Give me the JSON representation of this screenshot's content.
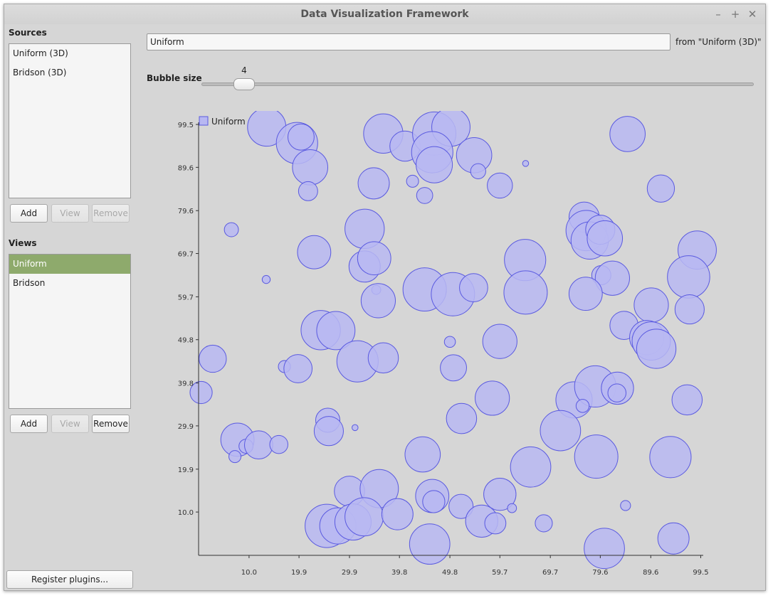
{
  "window": {
    "title": "Data Visualization Framework"
  },
  "sidebar": {
    "sources_label": "Sources",
    "sources": [
      "Uniform (3D)",
      "Bridson (3D)"
    ],
    "sources_buttons": {
      "add": "Add",
      "view": "View",
      "remove": "Remove"
    },
    "views_label": "Views",
    "views": [
      "Uniform",
      "Bridson"
    ],
    "views_selected": "Uniform",
    "views_buttons": {
      "add": "Add",
      "view": "View",
      "remove": "Remove"
    },
    "register_button": "Register plugins..."
  },
  "main": {
    "view_name": "Uniform",
    "from_label": "from \"Uniform (3D)\"",
    "bubble_size_label": "Bubble size",
    "bubble_size_value": "4"
  },
  "colors": {
    "bubble_fill": "#b8b8f2",
    "bubble_stroke": "#5a5ae0",
    "selected": "#8eaa6c"
  },
  "chart_data": {
    "type": "scatter",
    "legend": "Uniform",
    "legend_position": "top-left",
    "xlim": [
      0,
      100
    ],
    "ylim": [
      0,
      100
    ],
    "xticks": [
      "10.0",
      "19.9",
      "29.9",
      "39.8",
      "49.8",
      "59.7",
      "69.7",
      "79.6",
      "89.6",
      "99.5"
    ],
    "yticks": [
      "10.0",
      "19.9",
      "29.9",
      "39.8",
      "49.8",
      "59.7",
      "69.7",
      "79.6",
      "89.6",
      "99.5"
    ],
    "grid": false,
    "points": [
      [
        13.5,
        98.9,
        3.8
      ],
      [
        19.5,
        95.2,
        4.1
      ],
      [
        20.3,
        96.6,
        2.6
      ],
      [
        22.1,
        89.6,
        3.5
      ],
      [
        21.7,
        84.1,
        1.9
      ],
      [
        36.6,
        97.4,
        3.9
      ],
      [
        40.9,
        94.5,
        3.0
      ],
      [
        46.7,
        97.4,
        4.3
      ],
      [
        50.0,
        98.9,
        3.8
      ],
      [
        46.3,
        93.1,
        4.1
      ],
      [
        46.7,
        90.2,
        3.6
      ],
      [
        54.6,
        92.4,
        3.5
      ],
      [
        55.4,
        88.7,
        1.5
      ],
      [
        34.7,
        85.9,
        3.1
      ],
      [
        42.4,
        86.4,
        1.2
      ],
      [
        44.8,
        83.1,
        1.6
      ],
      [
        59.7,
        85.4,
        2.5
      ],
      [
        64.8,
        90.5,
        0.6
      ],
      [
        85.0,
        97.3,
        3.5
      ],
      [
        91.6,
        84.7,
        2.7
      ],
      [
        6.5,
        75.2,
        1.4
      ],
      [
        32.9,
        75.4,
        3.9
      ],
      [
        22.9,
        70.0,
        3.3
      ],
      [
        32.9,
        66.7,
        3.1
      ],
      [
        34.8,
        68.6,
        3.3
      ],
      [
        76.4,
        78.1,
        3.0
      ],
      [
        76.8,
        75.0,
        4.0
      ],
      [
        77.5,
        72.7,
        3.7
      ],
      [
        79.6,
        75.2,
        2.9
      ],
      [
        80.5,
        73.2,
        3.5
      ],
      [
        98.8,
        70.5,
        3.8
      ],
      [
        64.7,
        68.2,
        4.1
      ],
      [
        79.8,
        64.7,
        1.9
      ],
      [
        82.0,
        64.0,
        3.4
      ],
      [
        97.1,
        64.3,
        4.2
      ],
      [
        13.4,
        63.7,
        0.8
      ],
      [
        44.8,
        61.4,
        4.3
      ],
      [
        50.4,
        60.3,
        4.3
      ],
      [
        54.5,
        61.8,
        2.8
      ],
      [
        64.8,
        60.7,
        4.3
      ],
      [
        76.7,
        60.4,
        3.3
      ],
      [
        35.2,
        61.3,
        0.9
      ],
      [
        35.6,
        58.8,
        3.4
      ],
      [
        89.7,
        57.8,
        3.4
      ],
      [
        97.3,
        56.8,
        2.9
      ],
      [
        24.2,
        52.0,
        3.9
      ],
      [
        27.2,
        51.9,
        3.8
      ],
      [
        84.3,
        53.1,
        2.8
      ],
      [
        59.7,
        49.4,
        3.4
      ],
      [
        49.8,
        49.3,
        1.1
      ],
      [
        88.8,
        50.3,
        3.4
      ],
      [
        89.7,
        49.5,
        3.8
      ],
      [
        90.7,
        47.7,
        3.9
      ],
      [
        2.8,
        45.4,
        2.7
      ],
      [
        31.5,
        44.8,
        4.1
      ],
      [
        36.6,
        45.6,
        3.0
      ],
      [
        17.0,
        43.6,
        1.2
      ],
      [
        19.7,
        43.1,
        2.8
      ],
      [
        50.5,
        43.3,
        2.6
      ],
      [
        0.5,
        37.6,
        2.2
      ],
      [
        58.2,
        36.3,
        3.4
      ],
      [
        74.4,
        35.9,
        3.6
      ],
      [
        78.6,
        39.0,
        4.1
      ],
      [
        83.0,
        38.6,
        3.2
      ],
      [
        82.9,
        37.5,
        1.8
      ],
      [
        76.1,
        34.5,
        1.3
      ],
      [
        96.8,
        35.9,
        3.0
      ],
      [
        25.6,
        31.2,
        2.4
      ],
      [
        25.8,
        28.7,
        2.9
      ],
      [
        52.1,
        31.6,
        3.0
      ],
      [
        31.0,
        29.5,
        0.6
      ],
      [
        71.7,
        28.8,
        4.0
      ],
      [
        7.7,
        26.7,
        3.3
      ],
      [
        9.4,
        25.2,
        1.4
      ],
      [
        11.9,
        25.5,
        2.8
      ],
      [
        15.9,
        25.6,
        1.8
      ],
      [
        7.2,
        22.8,
        1.2
      ],
      [
        44.4,
        23.3,
        3.5
      ],
      [
        65.8,
        20.4,
        4.0
      ],
      [
        78.8,
        22.8,
        4.3
      ],
      [
        93.5,
        22.7,
        4.1
      ],
      [
        29.9,
        14.8,
        3.0
      ],
      [
        35.8,
        15.4,
        3.8
      ],
      [
        46.3,
        13.7,
        3.3
      ],
      [
        46.6,
        12.4,
        2.2
      ],
      [
        59.7,
        14.1,
        3.2
      ],
      [
        52.0,
        11.3,
        2.4
      ],
      [
        62.1,
        10.9,
        0.9
      ],
      [
        84.6,
        11.5,
        1.0
      ],
      [
        25.4,
        6.8,
        4.3
      ],
      [
        27.6,
        6.8,
        3.6
      ],
      [
        30.6,
        7.7,
        3.6
      ],
      [
        32.8,
        8.9,
        3.8
      ],
      [
        39.4,
        9.5,
        3.1
      ],
      [
        56.1,
        7.9,
        3.2
      ],
      [
        58.8,
        7.4,
        2.1
      ],
      [
        68.4,
        7.4,
        1.7
      ],
      [
        45.8,
        2.6,
        4.0
      ],
      [
        80.4,
        1.6,
        4.0
      ],
      [
        94.1,
        3.9,
        3.1
      ]
    ]
  }
}
